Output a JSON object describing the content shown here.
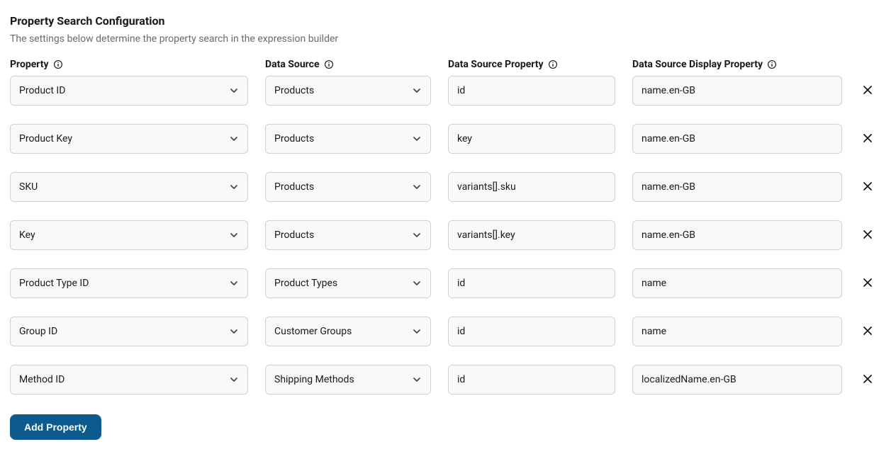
{
  "title": "Property Search Configuration",
  "description": "The settings below determine the property search in the expression builder",
  "headers": {
    "property": "Property",
    "dataSource": "Data Source",
    "dataSourceProperty": "Data Source Property",
    "dataSourceDisplayProperty": "Data Source Display Property"
  },
  "rows": [
    {
      "property": "Product ID",
      "dataSource": "Products",
      "dsProp": "id",
      "dsDisp": "name.en-GB"
    },
    {
      "property": "Product Key",
      "dataSource": "Products",
      "dsProp": "key",
      "dsDisp": "name.en-GB"
    },
    {
      "property": "SKU",
      "dataSource": "Products",
      "dsProp": "variants[].sku",
      "dsDisp": "name.en-GB"
    },
    {
      "property": "Key",
      "dataSource": "Products",
      "dsProp": "variants[].key",
      "dsDisp": "name.en-GB"
    },
    {
      "property": "Product Type ID",
      "dataSource": "Product Types",
      "dsProp": "id",
      "dsDisp": "name"
    },
    {
      "property": "Group ID",
      "dataSource": "Customer Groups",
      "dsProp": "id",
      "dsDisp": "name"
    },
    {
      "property": "Method ID",
      "dataSource": "Shipping Methods",
      "dsProp": "id",
      "dsDisp": "localizedName.en-GB"
    }
  ],
  "actions": {
    "addProperty": "Add Property"
  }
}
